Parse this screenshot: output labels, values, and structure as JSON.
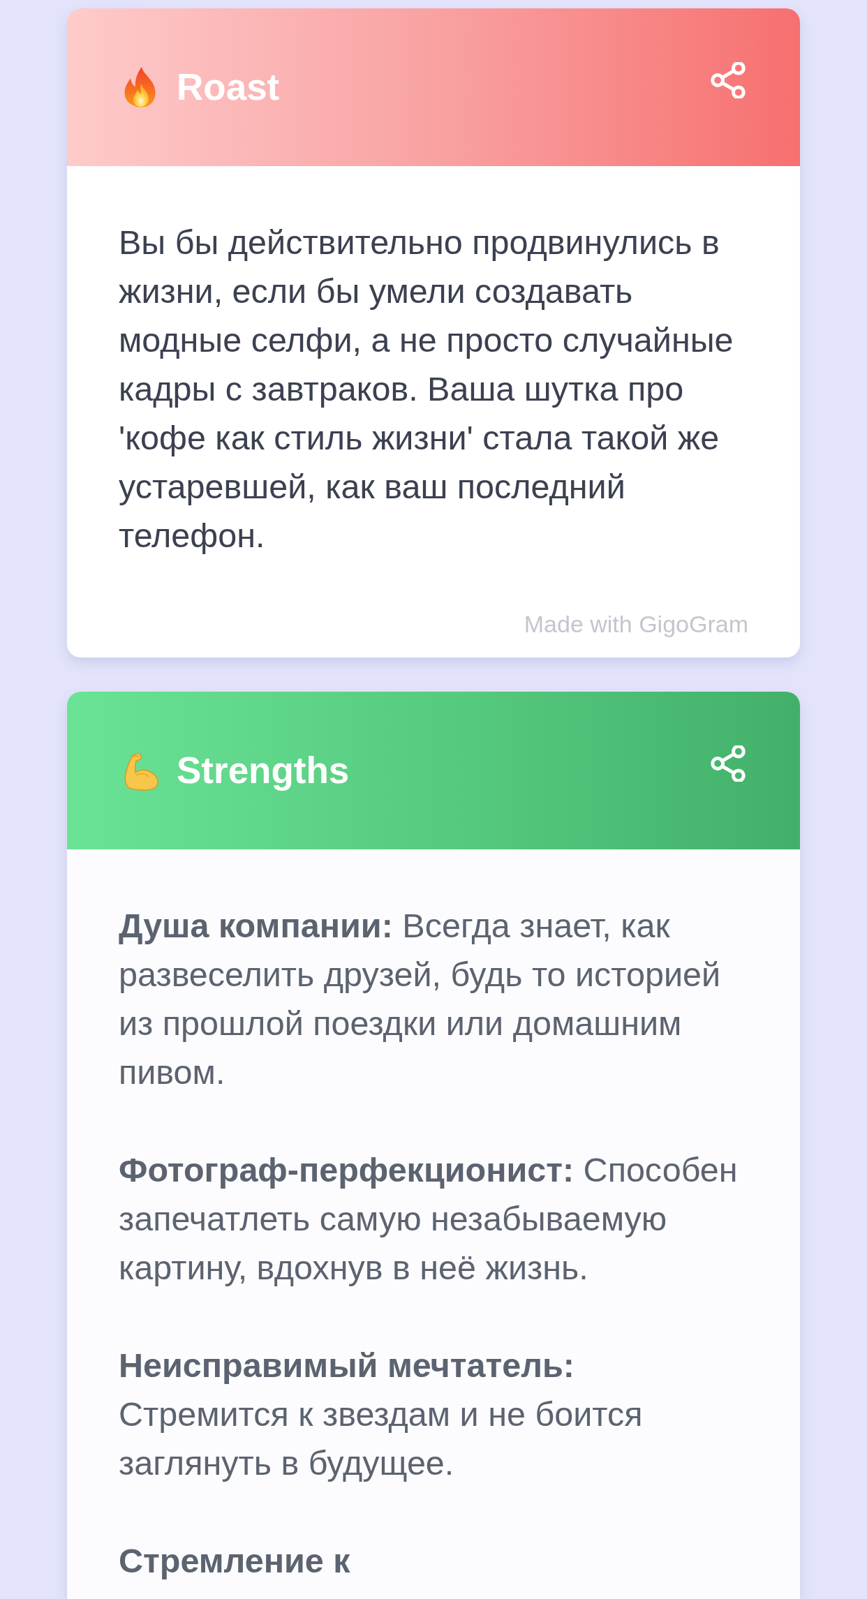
{
  "cards": [
    {
      "kind": "roast",
      "title": "Roast",
      "text": "Вы бы действительно продвинулись в жизни, если бы умели создавать модные селфи, а не просто случайные кадры с завтраков. Ваша шутка про 'кофе как стиль жизни' стала такой же устаревшей, как ваш последний телефон.",
      "footer": "Made with GigoGram"
    },
    {
      "kind": "strengths",
      "title": "Strengths",
      "items": [
        {
          "label": "Душа компании:",
          "text": "Всегда знает, как развеселить друзей, будь то историей из прошлой поездки или домашним пивом."
        },
        {
          "label": "Фотограф-перфекционист:",
          "text": "Способен запечатлеть самую незабываемую картину, вдохнув в неё жизнь."
        },
        {
          "label": "Неисправимый мечтатель:",
          "text": "Стремится к звездам и не боится заглянуть в будущее."
        },
        {
          "label": "Стремление к"
        }
      ]
    }
  ]
}
